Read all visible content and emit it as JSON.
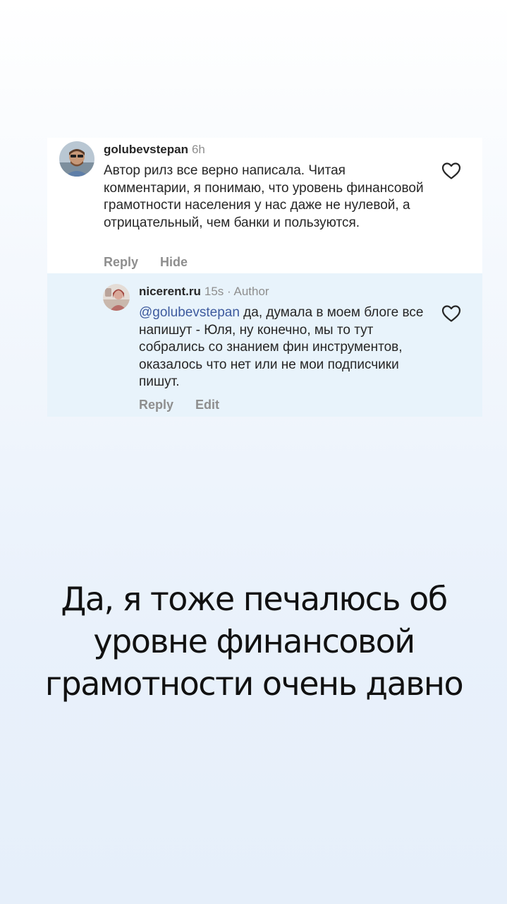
{
  "comments": [
    {
      "username": "golubevstepan",
      "time": "6h",
      "text": "Автор рилз все верно написала. Читая комментарии, я понимаю, что уровень финансовой грамотности населения у нас даже не нулевой, а отрицательный, чем банки и пользуются.",
      "actions": [
        "Reply",
        "Hide"
      ],
      "like_icon": "heart-outline-icon"
    }
  ],
  "reply": {
    "username": "nicerent.ru",
    "time": "15s",
    "separator": "·",
    "author_badge": "Author",
    "mention": "@golubevstepan",
    "text": " да, думала в моем блоге все напишут - Юля, ну конечно, мы то тут собрались со знанием фин инструментов, оказалось что нет или не мои подписчики пишут.",
    "actions": [
      "Reply",
      "Edit"
    ],
    "like_icon": "heart-outline-icon"
  },
  "caption": "Да, я тоже печалюсь об уровне финансовой грамотности очень давно",
  "colors": {
    "reply_highlight": "#e8f3fb",
    "mention": "#3d5a9e",
    "secondary_text": "#8e8e8e",
    "primary_text": "#262626"
  }
}
